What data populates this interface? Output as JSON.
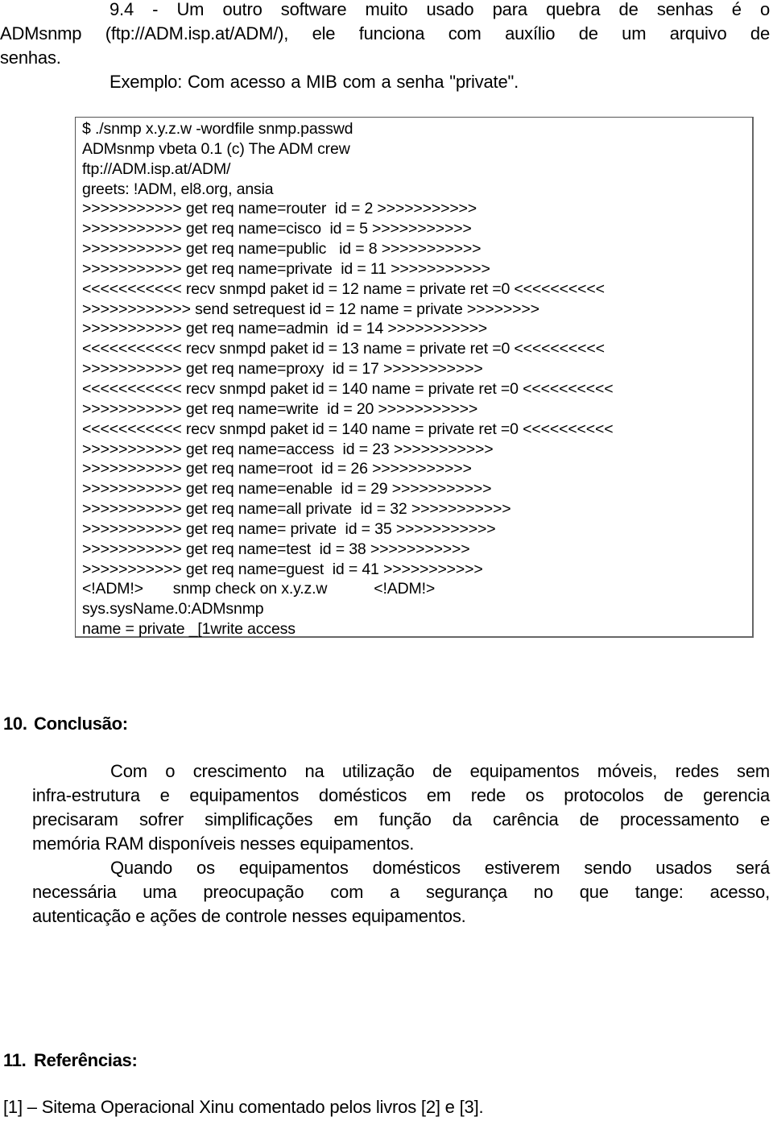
{
  "section_9_4": {
    "lines": [
      "9.4 - Um outro software muito usado para quebra de senhas é o",
      "ADMsnmp (ftp://ADM.isp.at/ADM/), ele funciona com auxílio de um arquivo de",
      "senhas."
    ],
    "example_intro": "Exemplo:  Com acesso a MIB com a senha \"private\"."
  },
  "terminal_output": {
    "lines": [
      "$ ./snmp x.y.z.w -wordfile snmp.passwd",
      "ADMsnmp vbeta 0.1 (c) The ADM crew",
      "ftp://ADM.isp.at/ADM/",
      "greets: !ADM, el8.org, ansia",
      ">>>>>>>>>>> get req name=router  id = 2 >>>>>>>>>>>",
      ">>>>>>>>>>> get req name=cisco  id = 5 >>>>>>>>>>>",
      ">>>>>>>>>>> get req name=public   id = 8 >>>>>>>>>>>",
      ">>>>>>>>>>> get req name=private  id = 11 >>>>>>>>>>>",
      "<<<<<<<<<<< recv snmpd paket id = 12 name = private ret =0 <<<<<<<<<<",
      ">>>>>>>>>>>> send setrequest id = 12 name = private >>>>>>>>",
      ">>>>>>>>>>> get req name=admin  id = 14 >>>>>>>>>>>",
      "<<<<<<<<<<< recv snmpd paket id = 13 name = private ret =0 <<<<<<<<<<",
      ">>>>>>>>>>> get req name=proxy  id = 17 >>>>>>>>>>>",
      "<<<<<<<<<<< recv snmpd paket id = 140 name = private ret =0 <<<<<<<<<<",
      ">>>>>>>>>>> get req name=write  id = 20 >>>>>>>>>>>",
      "<<<<<<<<<<< recv snmpd paket id = 140 name = private ret =0 <<<<<<<<<<",
      ">>>>>>>>>>> get req name=access  id = 23 >>>>>>>>>>>",
      ">>>>>>>>>>> get req name=root  id = 26 >>>>>>>>>>>",
      ">>>>>>>>>>> get req name=enable  id = 29 >>>>>>>>>>>",
      ">>>>>>>>>>> get req name=all private  id = 32 >>>>>>>>>>>",
      ">>>>>>>>>>> get req name= private  id = 35 >>>>>>>>>>>",
      ">>>>>>>>>>> get req name=test  id = 38 >>>>>>>>>>>",
      ">>>>>>>>>>> get req name=guest  id = 41 >>>>>>>>>>>",
      "<!ADM!>       snmp check on x.y.z.w           <!ADM!>",
      "sys.sysName.0:ADMsnmp",
      "name = private _[1write access"
    ]
  },
  "section_10": {
    "number": "10.",
    "title": "Conclusão:",
    "paragraph_1_lines": [
      "Com o crescimento na utilização de equipamentos móveis, redes sem",
      "infra-estrutura e equipamentos domésticos em rede os protocolos de gerencia",
      "precisaram sofrer simplificações em função da carência de processamento e",
      "memória RAM disponíveis nesses equipamentos."
    ],
    "paragraph_2_lines": [
      "Quando os equipamentos domésticos estiverem sendo usados será",
      "necessária uma preocupação com a segurança no que tange: acesso,",
      "autenticação e ações de controle nesses equipamentos."
    ]
  },
  "section_11": {
    "number": "11.",
    "title": "Referências:",
    "references": [
      "[1] – Sitema Operacional Xinu comentado pelos livros [2] e [3]."
    ]
  }
}
